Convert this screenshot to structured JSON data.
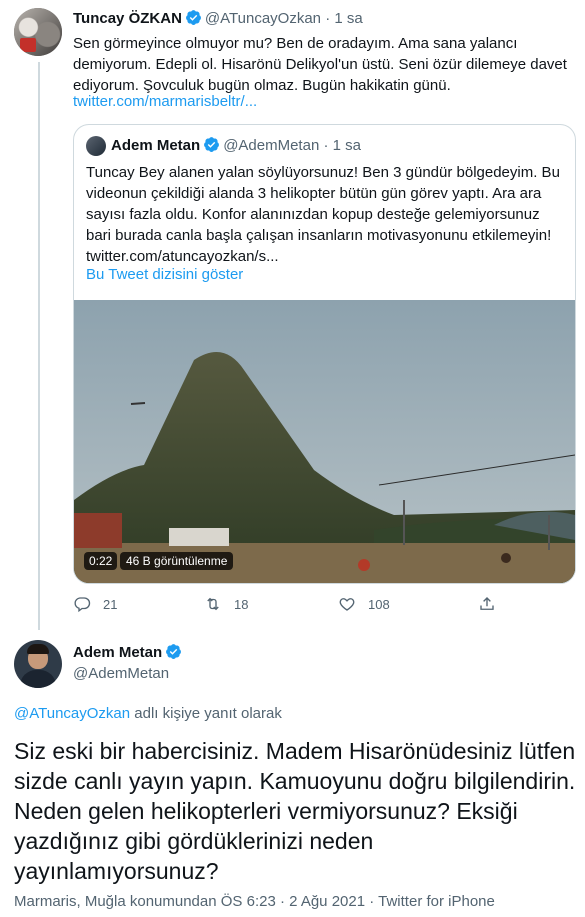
{
  "parent_tweet": {
    "name": "Tuncay ÖZKAN",
    "handle": "@ATuncayOzkan",
    "separator": "·",
    "time": "1 sa",
    "text": "Sen görmeyince olmuyor mu? Ben de oradayım. Ama sana yalancı demiyorum. Edepli ol. Hisarönü Delikyol'un üstü. Seni özür dilemeye davet ediyorum. Şovculuk bugün olmaz. Bugün hakikatin günü.",
    "link": "twitter.com/marmarisbeltr/...",
    "quoted": {
      "name": "Adem Metan",
      "handle": "@AdemMetan",
      "separator": "·",
      "time": "1 sa",
      "text": "Tuncay Bey alanen yalan söylüyorsunuz! Ben 3 gündür bölgedeyim. Bu videonun çekildiği alanda 3 helikopter bütün gün görev yaptı. Ara ara sayısı fazla oldu. Konfor alanınızdan kopup desteğe gelemiyorsunuz bari burada canla başla çalışan insanların motivasyonunu etkilemeyin! twitter.com/atuncayozkan/s...",
      "show_thread": "Bu Tweet dizisini göster",
      "video_time": "0:22",
      "video_views": "46 B görüntülenme"
    },
    "actions": {
      "replies": "21",
      "retweets": "18",
      "likes": "108"
    }
  },
  "main_tweet": {
    "name": "Adem Metan",
    "handle": "@AdemMetan",
    "reply_prefix_handle": "@ATuncayOzkan",
    "reply_suffix": " adlı kişiye yanıt olarak",
    "text": "Siz eski bir habercisiniz. Madem Hisarönüdesiniz lütfen sizde canlı yayın yapın. Kamuoyunu doğru bilgilendirin. Neden gelen helikopterleri vermiyorsunuz? Eksiği yazdığınız gibi gördüklerinizi neden yayınlamıyorsunuz?",
    "location": "Marmaris, Muğla konumundan",
    "time": "ÖS 6:23",
    "date": "2 Ağu 2021",
    "source": "Twitter for iPhone",
    "meta_separator": " · "
  },
  "colors": {
    "accent": "#1d9bf0",
    "muted": "#536471",
    "border": "#cfd9de",
    "text": "#0f1419"
  },
  "icons": [
    "verified-badge-icon",
    "reply-icon",
    "retweet-icon",
    "like-icon",
    "share-icon"
  ]
}
